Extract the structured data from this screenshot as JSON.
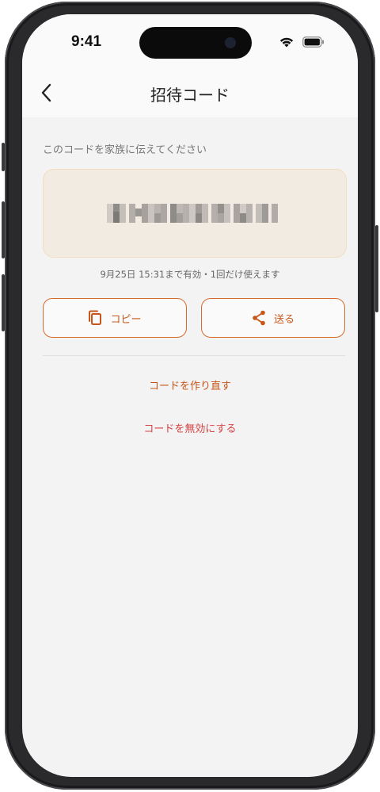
{
  "status": {
    "time": "9:41"
  },
  "nav": {
    "title": "招待コード",
    "back_icon": "chevron-left-icon"
  },
  "main": {
    "instruction": "このコードを家族に伝えてください",
    "code_value": "",
    "expiry": "9月25日 15:31まで有効・1回だけ使えます",
    "copy_label": "コピー",
    "send_label": "送る",
    "regenerate_label": "コードを作り直す",
    "invalidate_label": "コードを無効にする"
  },
  "colors": {
    "accent": "#c8561a",
    "danger": "#d64545",
    "code_bg": "#f1ebe2"
  }
}
